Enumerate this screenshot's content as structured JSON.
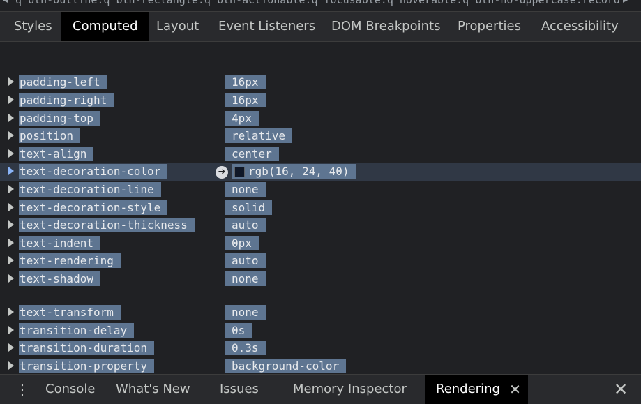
{
  "breadcrumb": {
    "text": "q btn-outline.q btn-rectangle.q btn-actionable.q focusable.q hoverable.q btn-no-uppercase.record"
  },
  "tabs": [
    "Styles",
    "Computed",
    "Layout",
    "Event Listeners",
    "DOM Breakpoints",
    "Properties",
    "Accessibility"
  ],
  "active_tab": "Computed",
  "properties": [
    {
      "name": "padding-left",
      "value": "16px"
    },
    {
      "name": "padding-right",
      "value": "16px"
    },
    {
      "name": "padding-top",
      "value": "4px"
    },
    {
      "name": "position",
      "value": "relative"
    },
    {
      "name": "text-align",
      "value": "center"
    },
    {
      "name": "text-decoration-color",
      "value": "rgb(16, 24, 40)",
      "selected": true,
      "swatch": "#101828"
    },
    {
      "name": "text-decoration-line",
      "value": "none"
    },
    {
      "name": "text-decoration-style",
      "value": "solid"
    },
    {
      "name": "text-decoration-thickness",
      "value": "auto"
    },
    {
      "name": "text-indent",
      "value": "0px"
    },
    {
      "name": "text-rendering",
      "value": "auto"
    },
    {
      "name": "text-shadow",
      "value": "none"
    },
    {
      "name": "text-transform",
      "value": "none"
    },
    {
      "name": "transition-delay",
      "value": "0s"
    },
    {
      "name": "transition-duration",
      "value": "0.3s"
    },
    {
      "name": "transition-property",
      "value": "background-color"
    }
  ],
  "drawer": {
    "tabs": [
      "Console",
      "What's New",
      "Issues",
      "Memory Inspector",
      "Rendering"
    ],
    "active_tab": "Rendering",
    "close_glyph": "✕"
  },
  "colors": {
    "background": "#202124",
    "highlight": "#5e7591",
    "selected_row": "#303845"
  }
}
